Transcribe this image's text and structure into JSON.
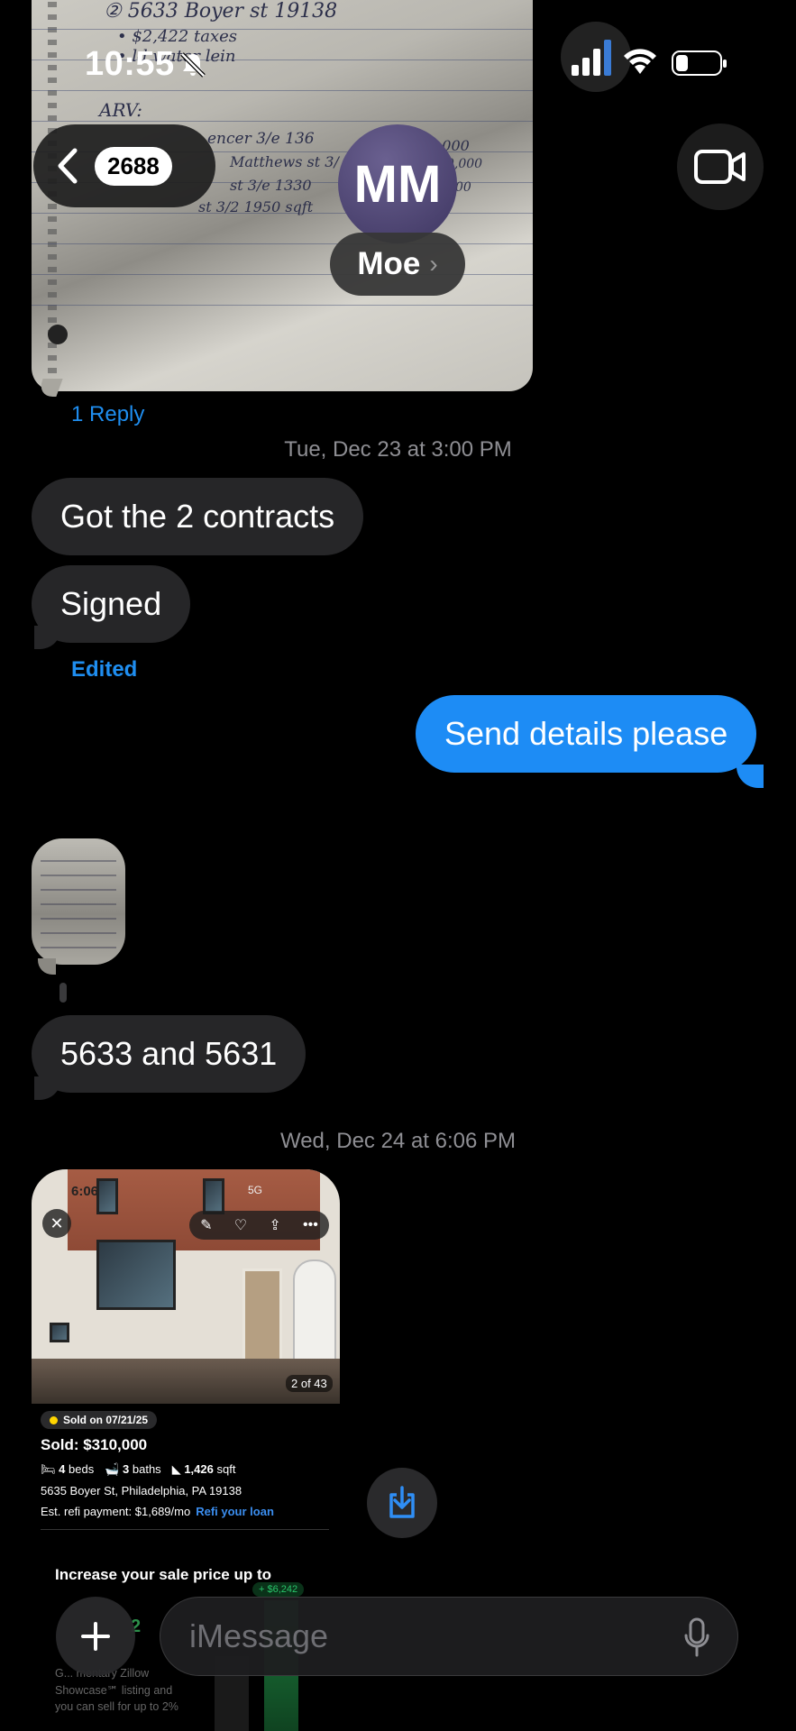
{
  "status_bar": {
    "time": "10:55"
  },
  "header": {
    "unread_count": "2688",
    "avatar_initials": "MM",
    "contact_name": "Moe",
    "contact_chevron": "›"
  },
  "note_photo": {
    "lines": [
      "② 5633 Boyer st 19138",
      "• $2,422 taxes",
      "• ld water lein",
      "ARV:",
      "encer 3/e 136",
      "6,000",
      "Matthews st 3/",
      "0,000",
      "st 3/e 1330",
      "00",
      "st 3/2 1950 sqft"
    ]
  },
  "messages": {
    "reply_link": "1 Reply",
    "timestamp_1": "Tue, Dec 23 at 3:00 PM",
    "msg_contracts": "Got the 2 contracts",
    "msg_signed": "Signed",
    "edited_label": "Edited",
    "msg_send_details": "Send details please",
    "msg_numbers": "5633 and 5631",
    "timestamp_2": "Wed, Dec 24 at 6:06 PM"
  },
  "listing_screenshot": {
    "time": "6:06",
    "status": "5G",
    "photo_count": "2 of 43",
    "sold_chip": "Sold on 07/21/25",
    "sold_price": "Sold: $310,000",
    "beds": "4",
    "beds_label": "beds",
    "baths": "3",
    "baths_label": "baths",
    "sqft": "1,426",
    "sqft_label": "sqft",
    "address": "5635 Boyer St, Philadelphia, PA 19138",
    "refi_text": "Est. refi payment: $1,689/mo",
    "refi_link": "Refi your loan",
    "promo_title": "Increase your sale price up to",
    "promo_amount": "2",
    "promo_delta": "+ $6,242",
    "promo_body": "G... mentary Zillow Showcase℠ listing and you can sell for up to 2%"
  },
  "compose": {
    "placeholder": "iMessage"
  }
}
